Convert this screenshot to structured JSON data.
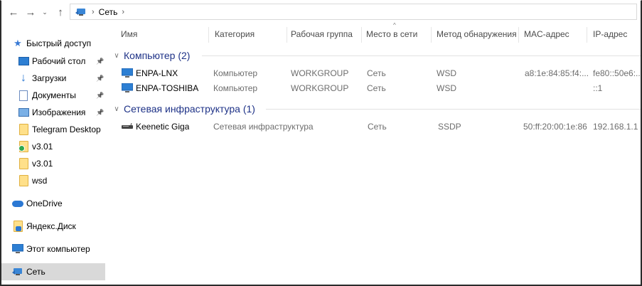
{
  "address": {
    "back_glyph": "←",
    "forward_glyph": "→",
    "recent_glyph": "⌄",
    "up_glyph": "↑",
    "crumbs": [
      "Сеть"
    ],
    "sep_glyph": "›"
  },
  "sidebar": {
    "quick_access": "Быстрый доступ",
    "items": [
      {
        "label": "Рабочий стол",
        "icon": "desktop-icon",
        "pinned": true
      },
      {
        "label": "Загрузки",
        "icon": "downloads-icon",
        "pinned": true
      },
      {
        "label": "Документы",
        "icon": "documents-icon",
        "pinned": true
      },
      {
        "label": "Изображения",
        "icon": "pictures-icon",
        "pinned": true
      },
      {
        "label": "Telegram Desktop",
        "icon": "folder-icon",
        "pinned": false
      },
      {
        "label": "v3.01",
        "icon": "folder-sync-icon",
        "pinned": false
      },
      {
        "label": "v3.01",
        "icon": "folder-icon",
        "pinned": false
      },
      {
        "label": "wsd",
        "icon": "folder-icon",
        "pinned": false
      }
    ],
    "onedrive": "OneDrive",
    "yandex": "Яндекс.Диск",
    "this_pc": "Этот компьютер",
    "network": "Сеть",
    "pin_glyph": "📌"
  },
  "columns": [
    "Имя",
    "Категория",
    "Рабочая группа",
    "Место в сети",
    "Метод обнаружения",
    "MAC-адрес",
    "IP-адрес"
  ],
  "sort_glyph": "^",
  "groups": [
    {
      "title": "Компьютер (2)",
      "chevron": "∨",
      "rows": [
        {
          "name": "ENPA-LNX",
          "category": "Компьютер",
          "workgroup": "WORKGROUP",
          "location": "Сеть",
          "method": "WSD",
          "mac": "a8:1e:84:85:f4:...",
          "ip": "fe80::50e6:..."
        },
        {
          "name": "ENPA-TOSHIBA",
          "category": "Компьютер",
          "workgroup": "WORKGROUP",
          "location": "Сеть",
          "method": "WSD",
          "mac": "",
          "ip": "::1"
        }
      ]
    },
    {
      "title": "Сетевая инфраструктура (1)",
      "chevron": "∨",
      "rows": [
        {
          "name": "Keenetic Giga",
          "category": "Сетевая инфраструктура",
          "workgroup": "",
          "location": "Сеть",
          "method": "SSDP",
          "mac": "50:ff:20:00:1e:86",
          "ip": "192.168.1.1"
        }
      ]
    }
  ]
}
